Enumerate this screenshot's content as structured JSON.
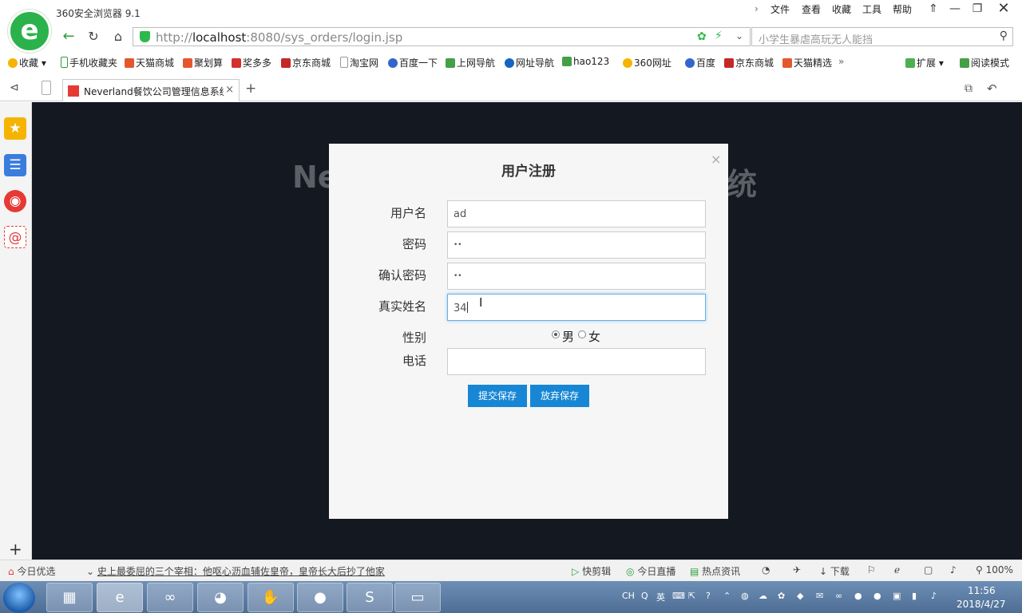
{
  "app": {
    "title": "360安全浏览器 9.1"
  },
  "menu": [
    "文件",
    "查看",
    "收藏",
    "工具",
    "帮助"
  ],
  "address": {
    "scheme": "http://",
    "host": "localhost",
    "rest": ":8080/sys_orders/login.jsp"
  },
  "search": {
    "placeholder": "小学生暴虐高玩无人能挡"
  },
  "bookmarks": [
    "收藏",
    "手机收藏夹",
    "天猫商城",
    "聚划算",
    "奖多多",
    "京东商城",
    "淘宝网",
    "百度一下",
    "上网导航",
    "网址导航",
    "hao123",
    "360网址",
    "百度",
    "京东商城",
    "天猫精选"
  ],
  "bookmarks_right": [
    "扩展",
    "阅读模式"
  ],
  "tab": {
    "title": "Neverland餐饮公司管理信息系统"
  },
  "background_title": {
    "left": "Ne",
    "right": "统"
  },
  "modal": {
    "title": "用户注册",
    "close": "×",
    "fields": {
      "username": {
        "label": "用户名",
        "value": "ad"
      },
      "password": {
        "label": "密码",
        "value": "••"
      },
      "confirm": {
        "label": "确认密码",
        "value": "••"
      },
      "realname": {
        "label": "真实姓名",
        "value": "34"
      },
      "gender": {
        "label": "性别",
        "options": [
          "男",
          "女"
        ],
        "selected": "男"
      },
      "phone": {
        "label": "电话",
        "value": ""
      }
    },
    "buttons": {
      "submit": "提交保存",
      "cancel": "放弃保存"
    }
  },
  "statusbar": {
    "left": "今日优选",
    "news": "史上最委屈的三个宰相：他呕心沥血辅佐皇帝，皇帝长大后抄了他家",
    "right": [
      "快剪辑",
      "今日直播",
      "热点资讯",
      "下载"
    ],
    "zoom": "100%"
  },
  "taskbar": {
    "lang": "CH",
    "ime": "英",
    "time": "11:56",
    "date": "2018/4/27"
  }
}
